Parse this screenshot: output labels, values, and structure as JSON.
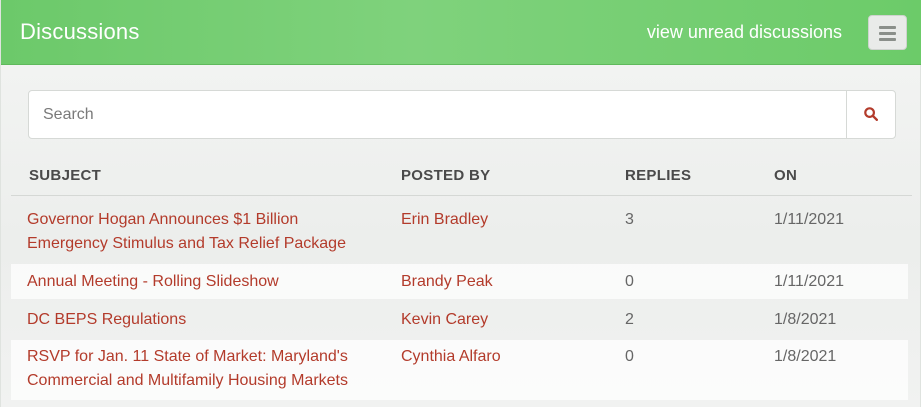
{
  "header": {
    "title": "Discussions",
    "unread_link": "view unread discussions",
    "menu_icon": "hamburger-menu-icon"
  },
  "search": {
    "placeholder": "Search",
    "value": "",
    "icon": "search-icon",
    "accent_color": "#b33b2b"
  },
  "table": {
    "columns": [
      "SUBJECT",
      "POSTED BY",
      "REPLIES",
      "ON"
    ],
    "rows": [
      {
        "subject_line1": "Governor Hogan Announces $1 Billion",
        "subject_line2": "Emergency Stimulus and Tax Relief Package",
        "posted_by": "Erin Bradley",
        "replies": "3",
        "on": "1/11/2021"
      },
      {
        "subject_line1": "Annual Meeting - Rolling Slideshow",
        "subject_line2": "",
        "posted_by": "Brandy Peak",
        "replies": "0",
        "on": "1/11/2021"
      },
      {
        "subject_line1": "DC BEPS Regulations",
        "subject_line2": "",
        "posted_by": "Kevin Carey",
        "replies": "2",
        "on": "1/8/2021"
      },
      {
        "subject_line1": "RSVP for Jan. 11 State of Market: Maryland's",
        "subject_line2": "Commercial and Multifamily Housing Markets",
        "posted_by": "Cynthia Alfaro",
        "replies": "0",
        "on": "1/8/2021"
      }
    ]
  },
  "colors": {
    "header_green": "#76ce73",
    "link_red": "#b33b2b",
    "muted_text": "#666666"
  }
}
